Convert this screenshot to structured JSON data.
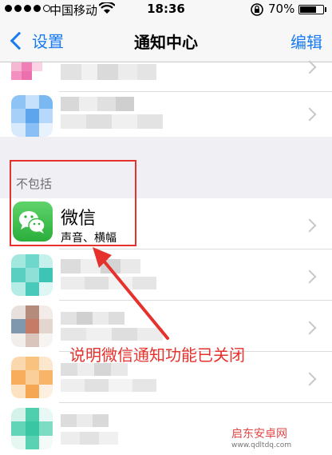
{
  "status_bar": {
    "carrier": "中国移动",
    "time": "18:36",
    "battery": "70%",
    "battery_level": 0.7
  },
  "nav": {
    "back_label": "设置",
    "title": "通知中心",
    "edit_label": "编辑"
  },
  "section_header": "不包括",
  "wechat": {
    "title": "微信",
    "subtitle": "声音、横幅"
  },
  "annotation": "说明微信通知功能已关闭",
  "watermark": {
    "title": "启东安卓网",
    "url": "www.qdltdq.com"
  },
  "colors": {
    "accent": "#1a7bf0",
    "annotation": "#e5322d",
    "wechat": "#2aae3c"
  }
}
